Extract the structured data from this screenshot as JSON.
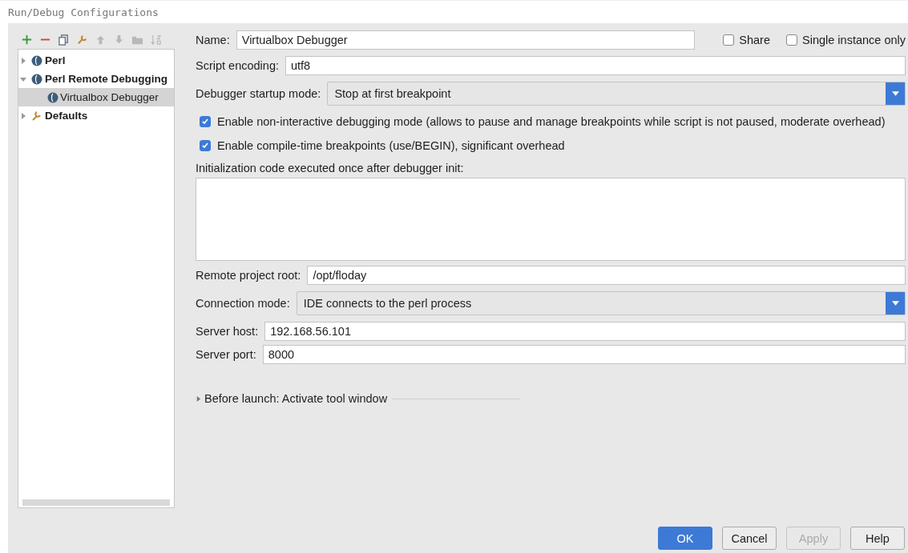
{
  "window": {
    "title": "Run/Debug Configurations"
  },
  "toolbar": [
    {
      "kind": "add",
      "disabled": false
    },
    {
      "kind": "remove",
      "disabled": false
    },
    {
      "kind": "copy",
      "disabled": false
    },
    {
      "kind": "wrench",
      "disabled": false
    },
    {
      "kind": "up",
      "disabled": true
    },
    {
      "kind": "down",
      "disabled": true
    },
    {
      "kind": "folder",
      "disabled": true
    },
    {
      "kind": "sort",
      "disabled": true
    }
  ],
  "tree": [
    {
      "label": "Perl",
      "kind": "perl",
      "expanded": false,
      "selected": false
    },
    {
      "label": "Perl Remote Debugging",
      "kind": "perl",
      "expanded": true,
      "selected": false,
      "children": [
        {
          "label": "Virtualbox Debugger",
          "kind": "perl",
          "selected": true
        }
      ]
    },
    {
      "label": "Defaults",
      "kind": "wrench",
      "expanded": false,
      "selected": false
    }
  ],
  "name": {
    "label": "Name:",
    "value": "Virtualbox Debugger"
  },
  "share": {
    "label": "Share",
    "checked": false
  },
  "single_instance": {
    "label": "Single instance only",
    "checked": false
  },
  "script_encoding": {
    "label": "Script encoding:",
    "value": "utf8"
  },
  "startup_mode": {
    "label": "Debugger startup mode:",
    "value": "Stop at first breakpoint"
  },
  "options": [
    {
      "label": "Enable non-interactive debugging mode (allows to pause and manage breakpoints while script is not paused, moderate overhead)",
      "checked": true
    },
    {
      "label": "Enable compile-time breakpoints (use/BEGIN), significant overhead",
      "checked": true
    }
  ],
  "init_code": {
    "label": "Initialization code executed once after debugger init:"
  },
  "remote_root": {
    "label": "Remote project root:",
    "value": "/opt/floday"
  },
  "connection_mode": {
    "label": "Connection mode:",
    "value": "IDE connects to the perl process"
  },
  "server_host": {
    "label": "Server host:",
    "value": "192.168.56.101"
  },
  "server_port": {
    "label": "Server port:",
    "value": "8000"
  },
  "before_launch": {
    "label": "Before launch: Activate tool window",
    "expanded": false
  },
  "buttons": [
    {
      "label": "OK",
      "kind": "primary",
      "disabled": false
    },
    {
      "label": "Cancel",
      "kind": "normal",
      "disabled": false
    },
    {
      "label": "Apply",
      "kind": "normal",
      "disabled": true
    },
    {
      "label": "Help",
      "kind": "normal",
      "disabled": false
    }
  ]
}
